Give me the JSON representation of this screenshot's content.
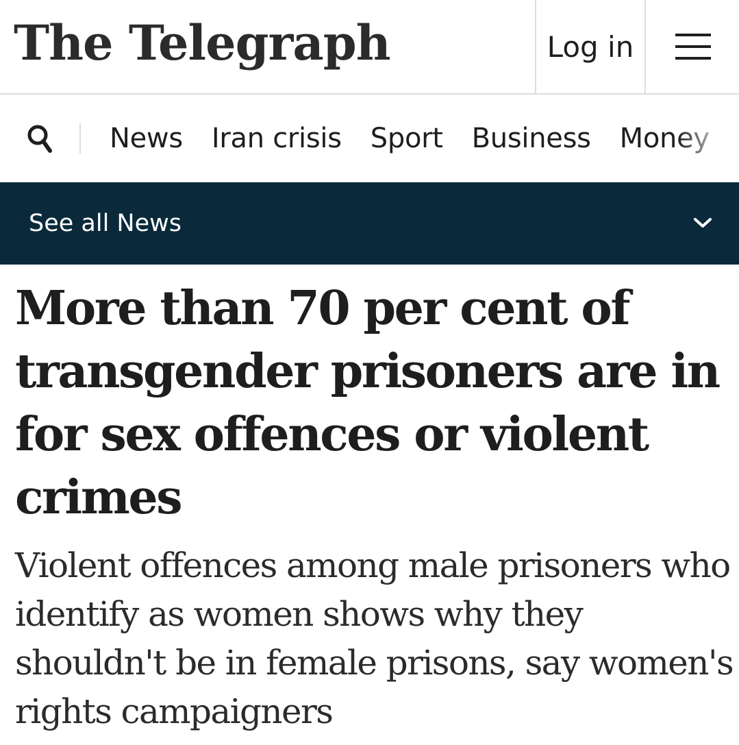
{
  "header": {
    "logo_text": "The Telegraph",
    "login_label": "Log in",
    "menu_icon": "hamburger-menu-icon"
  },
  "nav": {
    "search_icon": "search-icon",
    "items": [
      {
        "label": "News"
      },
      {
        "label": "Iran crisis"
      },
      {
        "label": "Sport"
      },
      {
        "label": "Business"
      },
      {
        "label": "Money"
      }
    ]
  },
  "section_bar": {
    "label": "See all News",
    "chevron_icon": "chevron-down-icon",
    "background_color": "#0a2a3b"
  },
  "article": {
    "headline": "More than 70 per cent of transgender prisoners are in for sex offences or violent crimes",
    "standfirst": "Violent offences among male prisoners who identify as women shows why they shouldn't be in female prisons, say women's rights campaigners"
  }
}
